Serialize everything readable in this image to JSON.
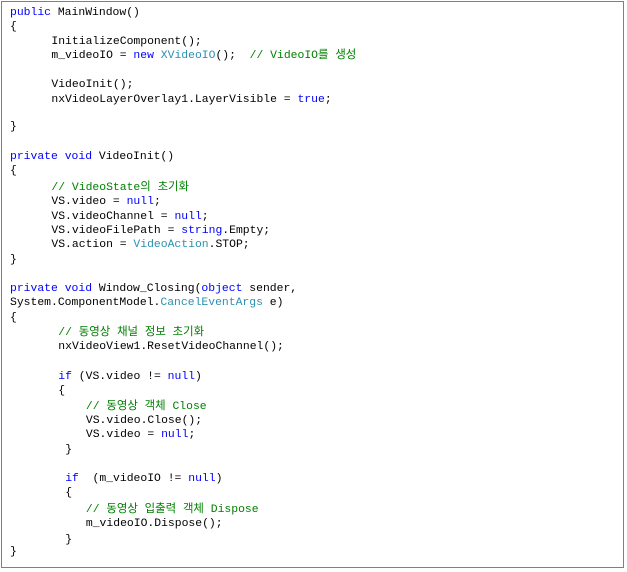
{
  "colors": {
    "keyword": "#0000ff",
    "type": "#2b91af",
    "comment": "#008000",
    "plain": "#000000",
    "border": "#7f7f7f"
  },
  "lines": [
    {
      "indent": 0,
      "tokens": [
        {
          "t": "kw",
          "v": "public"
        },
        {
          "t": "pl",
          "v": " MainWindow()"
        }
      ]
    },
    {
      "indent": 0,
      "tokens": [
        {
          "t": "pl",
          "v": "{"
        }
      ]
    },
    {
      "indent": 6,
      "tokens": [
        {
          "t": "pl",
          "v": "InitializeComponent();"
        }
      ]
    },
    {
      "indent": 6,
      "tokens": [
        {
          "t": "pl",
          "v": "m_videoIO = "
        },
        {
          "t": "kw",
          "v": "new"
        },
        {
          "t": "pl",
          "v": " "
        },
        {
          "t": "typ",
          "v": "XVideoIO"
        },
        {
          "t": "pl",
          "v": "();  "
        },
        {
          "t": "cm",
          "v": "// VideoIO를 생성"
        }
      ]
    },
    {
      "indent": 6,
      "tokens": [
        {
          "t": "pl",
          "v": "VideoInit();"
        }
      ]
    },
    {
      "indent": 6,
      "tokens": [
        {
          "t": "pl",
          "v": "nxVideoLayerOverlay1.LayerVisible = "
        },
        {
          "t": "kw",
          "v": "true"
        },
        {
          "t": "pl",
          "v": ";"
        }
      ]
    },
    {
      "indent": 0,
      "tokens": [
        {
          "t": "pl",
          "v": "}"
        }
      ]
    },
    {
      "indent": 0,
      "tokens": [
        {
          "t": "kw",
          "v": "private"
        },
        {
          "t": "pl",
          "v": " "
        },
        {
          "t": "kw",
          "v": "void"
        },
        {
          "t": "pl",
          "v": " VideoInit()"
        }
      ]
    },
    {
      "indent": 0,
      "tokens": [
        {
          "t": "pl",
          "v": "{"
        }
      ]
    },
    {
      "indent": 6,
      "tokens": [
        {
          "t": "cm",
          "v": "// VideoState의 초기화"
        }
      ]
    },
    {
      "indent": 6,
      "tokens": [
        {
          "t": "pl",
          "v": "VS.video = "
        },
        {
          "t": "kw",
          "v": "null"
        },
        {
          "t": "pl",
          "v": ";"
        }
      ]
    },
    {
      "indent": 6,
      "tokens": [
        {
          "t": "pl",
          "v": "VS.videoChannel = "
        },
        {
          "t": "kw",
          "v": "null"
        },
        {
          "t": "pl",
          "v": ";"
        }
      ]
    },
    {
      "indent": 6,
      "tokens": [
        {
          "t": "pl",
          "v": "VS.videoFilePath = "
        },
        {
          "t": "kw",
          "v": "string"
        },
        {
          "t": "pl",
          "v": ".Empty;"
        }
      ]
    },
    {
      "indent": 6,
      "tokens": [
        {
          "t": "pl",
          "v": "VS.action = "
        },
        {
          "t": "typ",
          "v": "VideoAction"
        },
        {
          "t": "pl",
          "v": ".STOP;"
        }
      ]
    },
    {
      "indent": 0,
      "tokens": [
        {
          "t": "pl",
          "v": "}"
        }
      ]
    },
    {
      "indent": 0,
      "tokens": [
        {
          "t": "kw",
          "v": "private"
        },
        {
          "t": "pl",
          "v": " "
        },
        {
          "t": "kw",
          "v": "void"
        },
        {
          "t": "pl",
          "v": " Window_Closing("
        },
        {
          "t": "kw",
          "v": "object"
        },
        {
          "t": "pl",
          "v": " sender,"
        }
      ]
    },
    {
      "indent": 0,
      "tokens": [
        {
          "t": "pl",
          "v": "System.ComponentModel."
        },
        {
          "t": "typ",
          "v": "CancelEventArgs"
        },
        {
          "t": "pl",
          "v": " e)"
        }
      ]
    },
    {
      "indent": 0,
      "tokens": [
        {
          "t": "pl",
          "v": "{"
        }
      ]
    },
    {
      "indent": 7,
      "tokens": [
        {
          "t": "cm",
          "v": "// 동영상 채널 정보 초기화"
        }
      ]
    },
    {
      "indent": 7,
      "tokens": [
        {
          "t": "pl",
          "v": "nxVideoView1.ResetVideoChannel();"
        }
      ]
    },
    {
      "indent": 7,
      "tokens": [
        {
          "t": "kw",
          "v": "if"
        },
        {
          "t": "pl",
          "v": " (VS.video != "
        },
        {
          "t": "kw",
          "v": "null"
        },
        {
          "t": "pl",
          "v": ")"
        }
      ]
    },
    {
      "indent": 7,
      "tokens": [
        {
          "t": "pl",
          "v": "{"
        }
      ]
    },
    {
      "indent": 11,
      "tokens": [
        {
          "t": "cm",
          "v": "// 동영상 객체 Close"
        }
      ]
    },
    {
      "indent": 11,
      "tokens": [
        {
          "t": "pl",
          "v": "VS.video.Close();"
        }
      ]
    },
    {
      "indent": 11,
      "tokens": [
        {
          "t": "pl",
          "v": "VS.video = "
        },
        {
          "t": "kw",
          "v": "null"
        },
        {
          "t": "pl",
          "v": ";"
        }
      ]
    },
    {
      "indent": 8,
      "tokens": [
        {
          "t": "pl",
          "v": "}"
        }
      ]
    },
    {
      "indent": 8,
      "tokens": [
        {
          "t": "kw",
          "v": "if"
        },
        {
          "t": "pl",
          "v": "  (m_videoIO != "
        },
        {
          "t": "kw",
          "v": "null"
        },
        {
          "t": "pl",
          "v": ")"
        }
      ]
    },
    {
      "indent": 8,
      "tokens": [
        {
          "t": "pl",
          "v": "{"
        }
      ]
    },
    {
      "indent": 11,
      "tokens": [
        {
          "t": "cm",
          "v": "// 동영상 입출력 객체 Dispose"
        }
      ]
    },
    {
      "indent": 11,
      "tokens": [
        {
          "t": "pl",
          "v": "m_videoIO.Dispose();"
        }
      ]
    },
    {
      "indent": 8,
      "tokens": [
        {
          "t": "pl",
          "v": "}"
        }
      ]
    },
    {
      "indent": 0,
      "tokens": [
        {
          "t": "pl",
          "v": "}"
        }
      ]
    }
  ]
}
